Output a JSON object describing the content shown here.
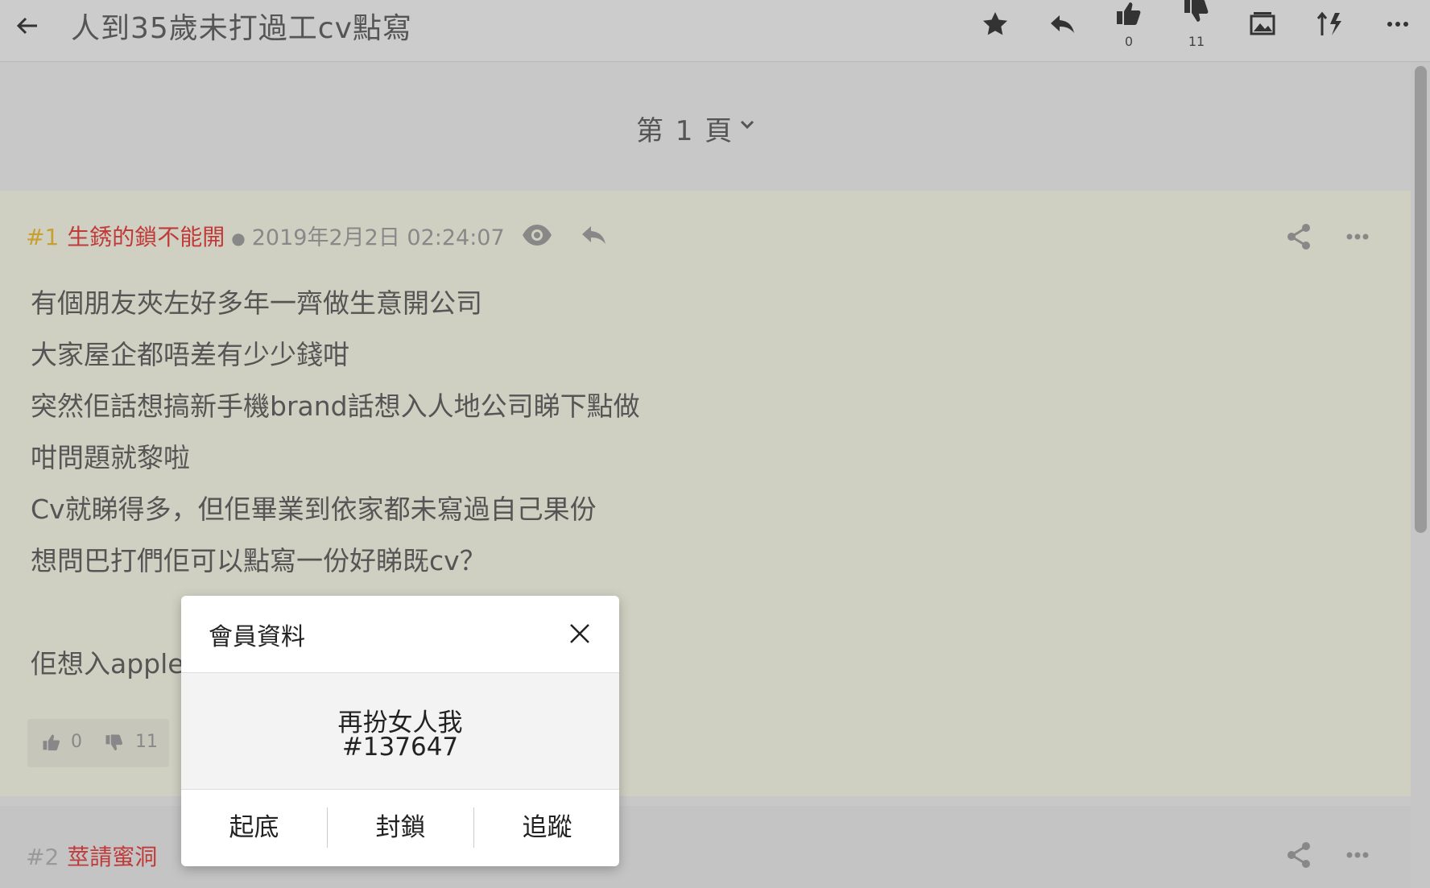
{
  "topbar": {
    "title": "人到35歲未打過工cv點寫",
    "upvotes": "0",
    "downvotes": "11"
  },
  "pager": {
    "label": "第 1 頁"
  },
  "posts": [
    {
      "number": "#1",
      "user": "生銹的鎖不能開",
      "date": "2019年2月2日 02:24:07",
      "lines": [
        "有個朋友夾左好多年一齊做生意開公司",
        "大家屋企都唔差有少少錢咁",
        "突然佢話想搞新手機brand話想入人地公司睇下點做",
        "咁問題就黎啦",
        "Cv就睇得多，但佢畢業到依家都未寫過自己果份",
        "想問巴打們佢可以點寫一份好睇既cv？",
        "",
        "佢想入apple"
      ],
      "upvotes": "0",
      "downvotes": "11"
    },
    {
      "number": "#2",
      "user": "莖請蜜洞"
    }
  ],
  "modal": {
    "title": "會員資料",
    "name": "再扮女人我",
    "id": "#137647",
    "actions": [
      "起底",
      "封鎖",
      "追蹤"
    ]
  }
}
